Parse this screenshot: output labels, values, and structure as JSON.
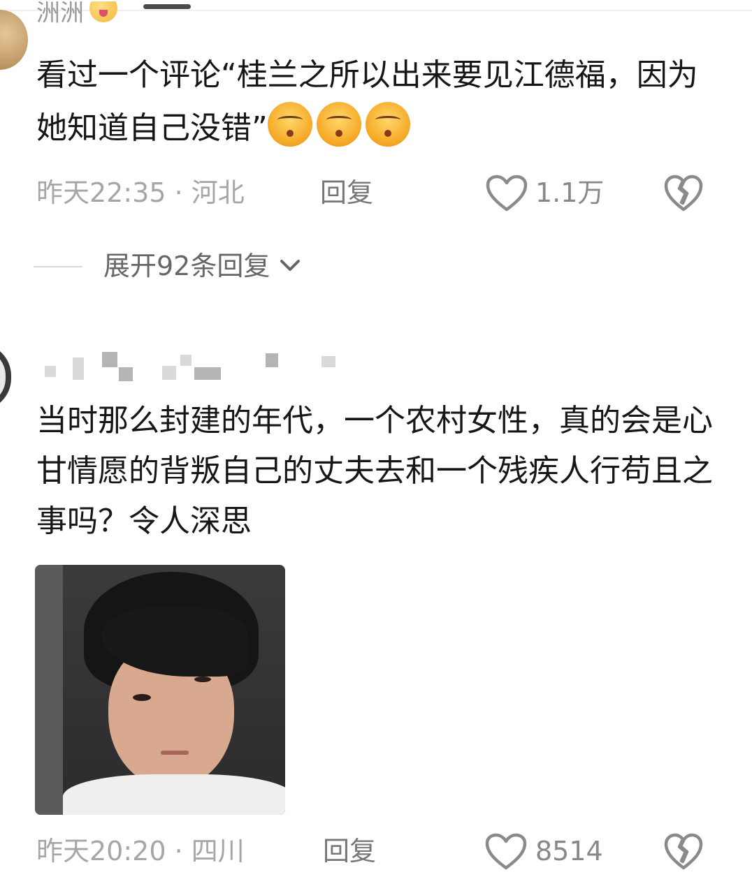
{
  "comment1": {
    "username": "洲洲",
    "text": "看过一个评论“桂兰之所以出来要见江德福，因为她知道自己没错”",
    "emoji_count": 3,
    "time": "昨天22:35",
    "separator": "·",
    "location": "河北",
    "reply_label": "回复",
    "likes": "1.1万"
  },
  "expand_replies": {
    "label": "展开92条回复"
  },
  "comment2": {
    "text": "当时那么封建的年代，一个农村女性，真的会是心甘情愿的背叛自己的丈夫去和一个残疾人行苟且之事吗？令人深思",
    "time": "昨天20:20",
    "separator": "·",
    "location": "四川",
    "reply_label": "回复",
    "likes": "8514"
  },
  "icons": {
    "like": "heart-outline-icon",
    "dislike": "broken-heart-icon",
    "expand": "chevron-down-icon"
  }
}
